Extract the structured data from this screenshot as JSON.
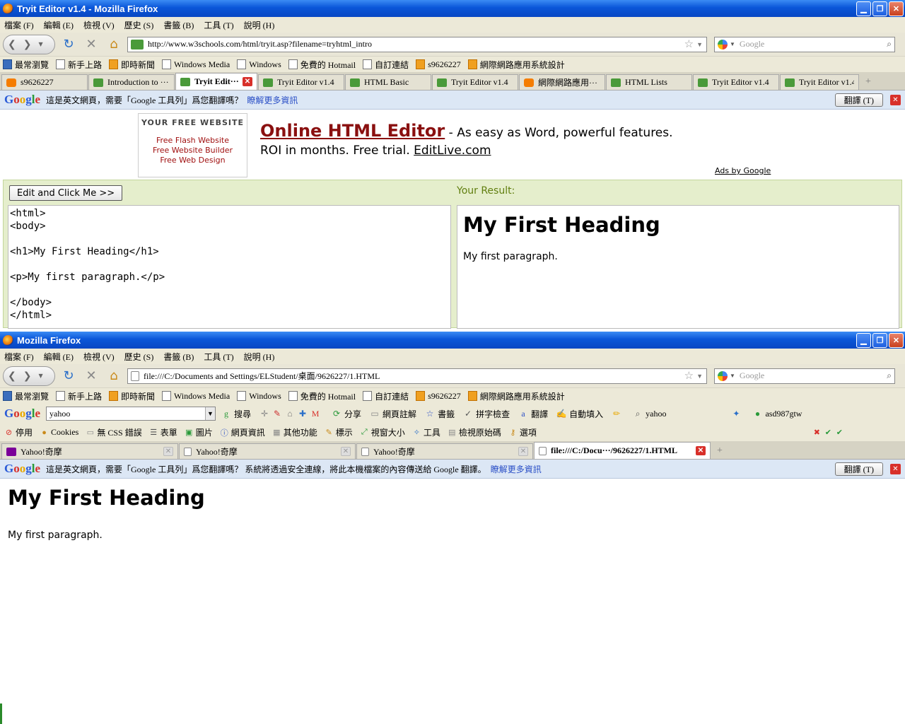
{
  "window1": {
    "title": "Tryit Editor v1.4 - Mozilla Firefox",
    "menu": [
      "檔案 (F)",
      "編輯 (E)",
      "檢視 (V)",
      "歷史 (S)",
      "書籤 (B)",
      "工具 (T)",
      "說明 (H)"
    ],
    "url": "http://www.w3schools.com/html/tryit.asp?filename=tryhtml_intro",
    "search_placeholder": "Google",
    "bookmarks": [
      "最常瀏覽",
      "新手上路",
      "即時新聞",
      "Windows Media",
      "Windows",
      "免費的 Hotmail",
      "自訂連結",
      "s9626227",
      "網際網路應用系統設計"
    ],
    "tabs": [
      "s9626227",
      "Introduction to ···",
      "Tryit Edit···",
      "Tryit Editor v1.4",
      "HTML Basic",
      "Tryit Editor v1.4",
      "網際網路應用···",
      "HTML Lists",
      "Tryit Editor v1.4",
      "Tryit Editor v1.4"
    ],
    "translate_msg": "這是英文網頁，需要「Google 工具列」爲您翻譯嗎？",
    "translate_more": "瞭解更多資訊",
    "translate_btn": "翻譯 (T)",
    "ad": {
      "box_heading": "YOUR FREE WEBSITE",
      "box_links": [
        "Free Flash Website",
        "Free Website Builder",
        "Free Web Design"
      ],
      "headline": "Online HTML Editor",
      "headline_rest": " - As easy as Word, powerful features.",
      "line2": "ROI in months. Free trial. ",
      "line2_link": "EditLive.com",
      "ads_by": "Ads by Google"
    },
    "tryit": {
      "button": "Edit and Click Me >>",
      "result_label": "Your Result:",
      "code": "<html>\n<body>\n\n<h1>My First Heading</h1>\n\n<p>My first paragraph.</p>\n\n</body>\n</html>",
      "result_h1": "My First Heading",
      "result_p": "My first paragraph."
    }
  },
  "window2": {
    "title": "Mozilla Firefox",
    "menu": [
      "檔案 (F)",
      "編輯 (E)",
      "檢視 (V)",
      "歷史 (S)",
      "書籤 (B)",
      "工具 (T)",
      "說明 (H)"
    ],
    "url": "file:///C:/Documents and Settings/ELStudent/桌面/9626227/1.HTML",
    "search_placeholder": "Google",
    "bookmarks": [
      "最常瀏覽",
      "新手上路",
      "即時新聞",
      "Windows Media",
      "Windows",
      "免費的 Hotmail",
      "自訂連結",
      "s9626227",
      "網際網路應用系統設計"
    ],
    "google_toolbar": {
      "query": "yahoo",
      "items": [
        "搜尋",
        "分享",
        "網頁註解",
        "書籤",
        "拼字檢查",
        "翻譯",
        "自動填入",
        "yahoo"
      ],
      "account": "asd987gtw"
    },
    "webdev": [
      "停用",
      "Cookies",
      "無 CSS 錯誤",
      "表單",
      "圖片",
      "網頁資訊",
      "其他功能",
      "標示",
      "視窗大小",
      "工具",
      "檢視原始碼",
      "選項"
    ],
    "tabs": [
      "Yahoo!奇摩",
      "Yahoo!奇摩",
      "Yahoo!奇摩",
      "file:///C:/Docu···/9626227/1.HTML"
    ],
    "translate_msg": "這是英文網頁，需要「Google 工具列」爲您翻譯嗎？ 系統將透過安全連線，將此本機檔案的內容傳送給 Google 翻譯。",
    "translate_more": "瞭解更多資訊",
    "translate_btn": "翻譯 (T)",
    "page_h1": "My First Heading",
    "page_p": "My first paragraph."
  }
}
